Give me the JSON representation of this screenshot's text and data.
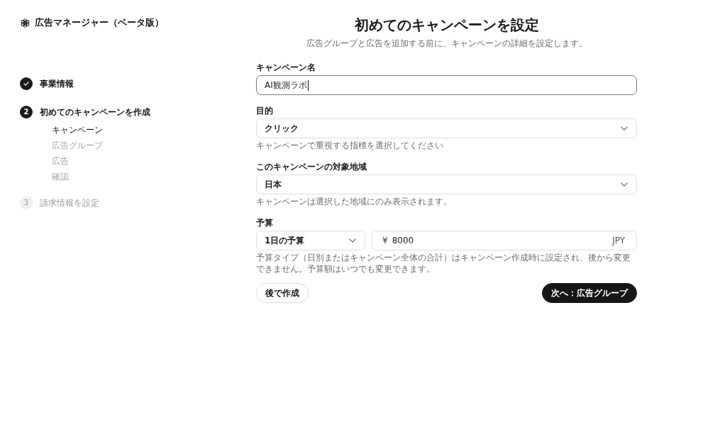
{
  "app": {
    "title": "広告マネージャー（ベータ版）"
  },
  "steps": [
    {
      "label": "事業情報",
      "completed": true,
      "selected": false
    },
    {
      "number": "2",
      "label": "初めてのキャンペーンを作成",
      "completed": false,
      "selected": true,
      "children": [
        {
          "label": "キャンペーン",
          "selected": true
        },
        {
          "label": "広告グループ",
          "selected": false
        },
        {
          "label": "広告",
          "selected": false
        },
        {
          "label": "確認",
          "selected": false
        }
      ]
    },
    {
      "number": "3",
      "label": "請求情報を設定",
      "completed": false,
      "selected": false
    }
  ],
  "header": {
    "title": "初めてのキャンペーンを設定",
    "subtitle": "広告グループと広告を追加する前に、キャンペーンの詳細を設定します。"
  },
  "fields": [
    {
      "kind": "text",
      "label": "キャンペーン名",
      "value": "AI観測ラボ",
      "focused": true
    },
    {
      "kind": "select",
      "label": "目的",
      "value": "クリック",
      "hint": "キャンペーンで重視する指標を選択してください"
    },
    {
      "kind": "select",
      "label": "このキャンペーンの対象地域",
      "value": "日本",
      "hint": "キャンペーンは選択した地域にのみ表示されます。"
    },
    {
      "kind": "budget",
      "label": "予算",
      "budget_type": "1日の予算",
      "currency_symbol": "¥",
      "amount": "8000",
      "currency": "JPY",
      "hint": "予算タイプ（日別またはキャンペーン全体の合計）はキャンペーン作成時に設定され、後から変更できません。予算額はいつでも変更できます。"
    }
  ],
  "buttons": [
    {
      "label": "後で作成",
      "kind": "secondary"
    },
    {
      "label": "次へ：広告グループ",
      "kind": "primary"
    }
  ]
}
